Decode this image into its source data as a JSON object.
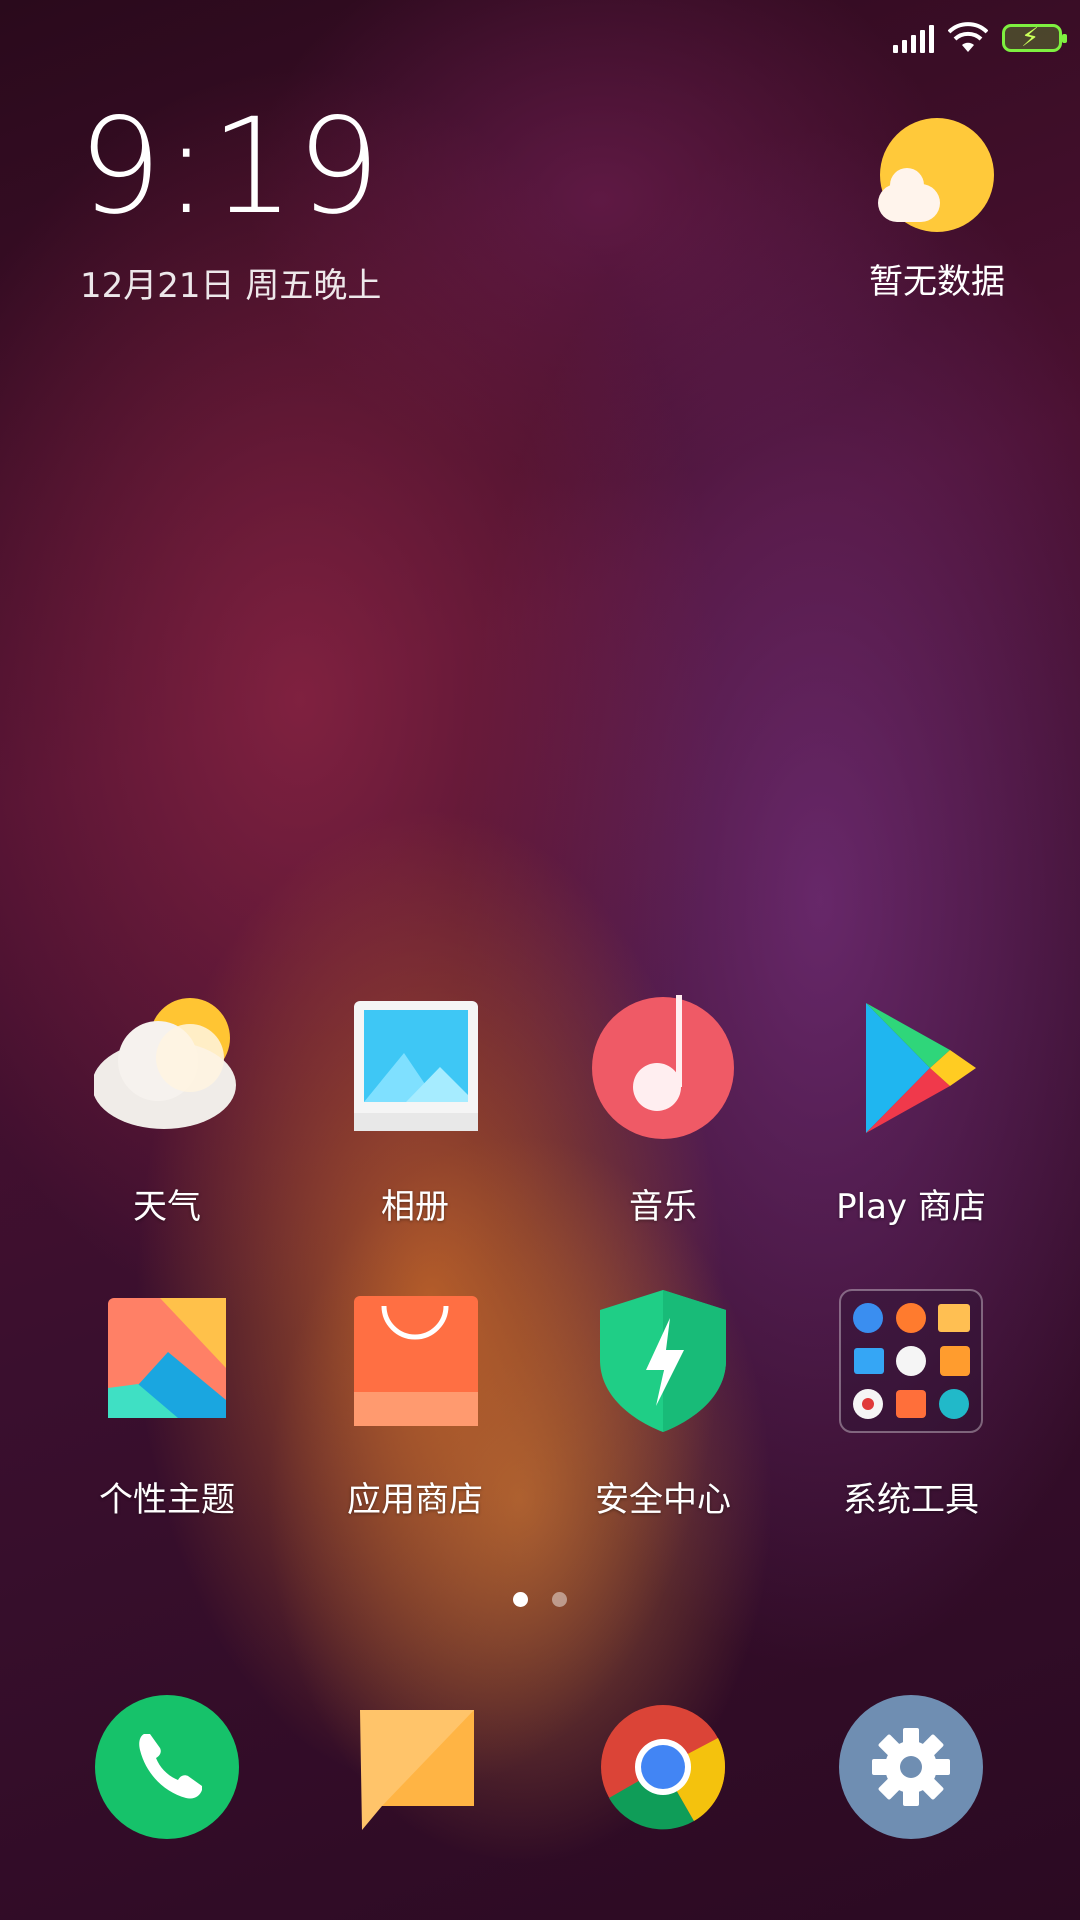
{
  "status_bar": {
    "icons": [
      "signal-icon",
      "wifi-icon",
      "battery-charging-icon"
    ]
  },
  "clock": {
    "time": "9:19",
    "date": "12月21日 周五晚上"
  },
  "weather_widget": {
    "text": "暂无数据",
    "icon": "sun-cloud-icon"
  },
  "apps_row1": [
    {
      "label": "天气",
      "icon": "weather-icon"
    },
    {
      "label": "相册",
      "icon": "gallery-icon"
    },
    {
      "label": "音乐",
      "icon": "music-icon"
    },
    {
      "label": "Play 商店",
      "icon": "play-store-icon"
    }
  ],
  "apps_row2": [
    {
      "label": "个性主题",
      "icon": "themes-icon"
    },
    {
      "label": "应用商店",
      "icon": "app-store-icon"
    },
    {
      "label": "安全中心",
      "icon": "security-icon"
    },
    {
      "label": "系统工具",
      "icon": "system-tools-folder-icon"
    }
  ],
  "page_indicator": {
    "pages": 2,
    "current": 1
  },
  "dock": [
    {
      "icon": "phone-icon"
    },
    {
      "icon": "messages-icon"
    },
    {
      "icon": "chrome-icon"
    },
    {
      "icon": "settings-icon"
    }
  ]
}
